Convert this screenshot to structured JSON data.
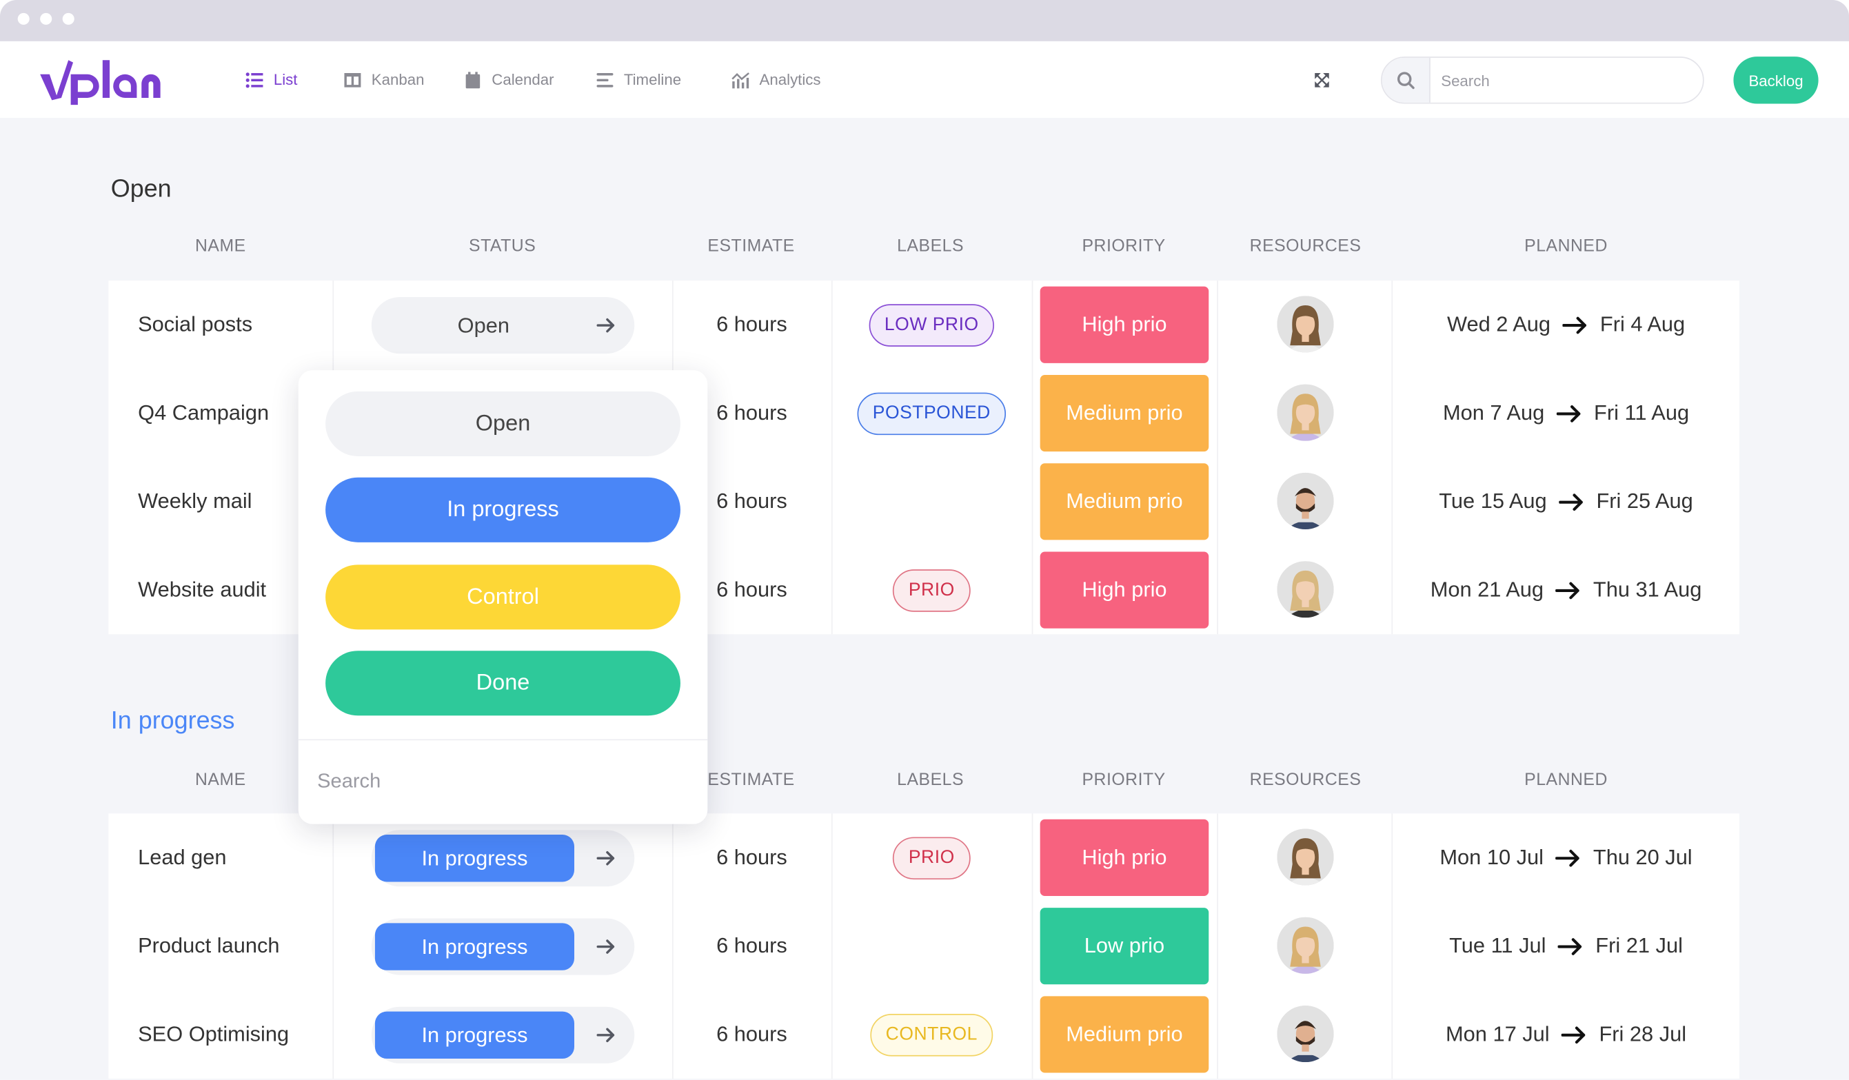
{
  "app": {
    "logo": "vplan",
    "brand_color": "#7b3fd0"
  },
  "nav": [
    {
      "label": "List",
      "icon": "list-icon",
      "active": true
    },
    {
      "label": "Kanban",
      "icon": "kanban-icon"
    },
    {
      "label": "Calendar",
      "icon": "calendar-icon"
    },
    {
      "label": "Timeline",
      "icon": "timeline-icon"
    },
    {
      "label": "Analytics",
      "icon": "analytics-icon"
    }
  ],
  "search": {
    "placeholder": "Search"
  },
  "backlog_label": "Backlog",
  "columns": [
    "NAME",
    "STATUS",
    "ESTIMATE",
    "LABELS",
    "PRIORITY",
    "RESOURCES",
    "PLANNED"
  ],
  "colors": {
    "high": "#f7627f",
    "medium": "#fbb24a",
    "low": "#2ec99a",
    "in_progress": "#4a86f7",
    "control": "#fdd736",
    "done": "#2ec99a"
  },
  "sections": [
    {
      "title": "Open",
      "title_color": "#333333",
      "rows": [
        {
          "name": "Social posts",
          "status": "Open",
          "estimate": "6 hours",
          "label": "LOW PRIO",
          "label_type": "purple",
          "priority": "High prio",
          "priority_level": "high",
          "avatar": "woman-brown-hair",
          "start": "Wed 2 Aug",
          "end": "Fri 4 Aug"
        },
        {
          "name": "Q4 Campaign",
          "status": "Open",
          "estimate": "6 hours",
          "label": "POSTPONED",
          "label_type": "blue",
          "priority": "Medium prio",
          "priority_level": "medium",
          "avatar": "woman-blonde-long",
          "start": "Mon 7 Aug",
          "end": "Fri 11 Aug"
        },
        {
          "name": "Weekly mail",
          "status": "Open",
          "estimate": "6 hours",
          "label": "",
          "label_type": "",
          "priority": "Medium prio",
          "priority_level": "medium",
          "avatar": "man-beard",
          "start": "Tue 15 Aug",
          "end": "Fri 25 Aug"
        },
        {
          "name": "Website audit",
          "status": "Open",
          "estimate": "6 hours",
          "label": "PRIO",
          "label_type": "red",
          "priority": "High prio",
          "priority_level": "high",
          "avatar": "woman-blonde",
          "start": "Mon 21 Aug",
          "end": "Thu 31 Aug"
        }
      ]
    },
    {
      "title": "In progress",
      "title_color": "#4a86f7",
      "rows": [
        {
          "name": "Lead gen",
          "status": "In progress",
          "estimate": "6 hours",
          "label": "PRIO",
          "label_type": "red",
          "priority": "High prio",
          "priority_level": "high",
          "avatar": "woman-brown-hair",
          "start": "Mon 10 Jul",
          "end": "Thu 20 Jul"
        },
        {
          "name": "Product launch",
          "status": "In progress",
          "estimate": "6 hours",
          "label": "",
          "label_type": "",
          "priority": "Low prio",
          "priority_level": "low",
          "avatar": "woman-blonde-long",
          "start": "Tue 11 Jul",
          "end": "Fri 21 Jul"
        },
        {
          "name": "SEO Optimising",
          "status": "In progress",
          "estimate": "6 hours",
          "label": "CONTROL",
          "label_type": "yellow",
          "priority": "Medium prio",
          "priority_level": "medium",
          "avatar": "man-beard",
          "start": "Mon 17 Jul",
          "end": "Fri 28 Jul"
        }
      ]
    }
  ],
  "status_dropdown": {
    "options": [
      {
        "label": "Open",
        "bg": "#f1f2f5",
        "fg": "#444444"
      },
      {
        "label": "In progress",
        "bg": "#4a86f7",
        "fg": "#ffffff"
      },
      {
        "label": "Control",
        "bg": "#fdd736",
        "fg": "#ffffff"
      },
      {
        "label": "Done",
        "bg": "#2ec99a",
        "fg": "#ffffff"
      }
    ],
    "search_placeholder": "Search"
  }
}
